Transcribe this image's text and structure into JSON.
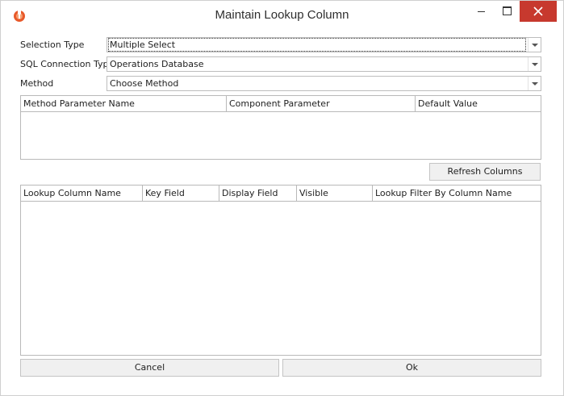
{
  "window": {
    "title": "Maintain Lookup Column"
  },
  "form": {
    "selection_type": {
      "label": "Selection Type",
      "value": "Multiple Select"
    },
    "sql_connection_type": {
      "label": "SQL Connection Type",
      "value": "Operations Database"
    },
    "method": {
      "label": "Method",
      "value": "Choose Method"
    }
  },
  "parameters_grid": {
    "columns": [
      "Method Parameter Name",
      "Component Parameter",
      "Default Value"
    ]
  },
  "refresh_button": "Refresh Columns",
  "lookup_grid": {
    "columns": [
      "Lookup Column Name",
      "Key Field",
      "Display Field",
      "Visible",
      "Lookup Filter By Column Name"
    ]
  },
  "footer": {
    "cancel": "Cancel",
    "ok": "Ok"
  },
  "colors": {
    "close_button": "#c7392e",
    "app_icon": "#e8592a"
  }
}
